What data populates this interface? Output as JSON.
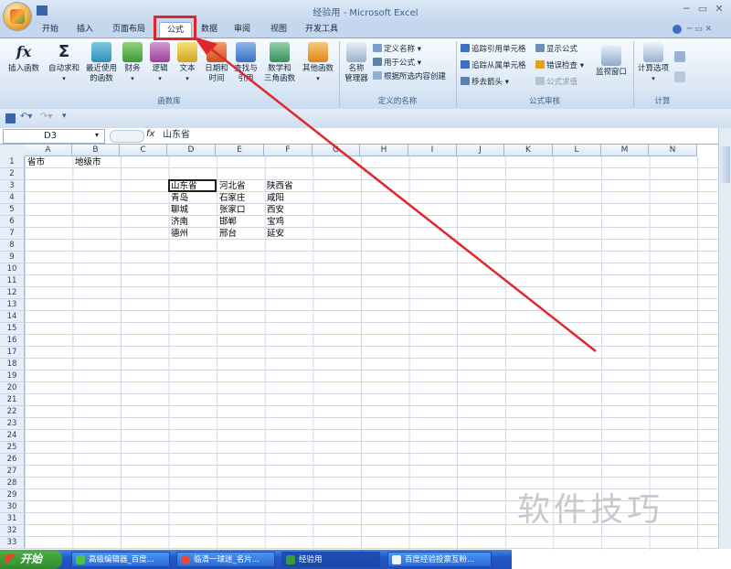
{
  "window": {
    "title": "经验用 - Microsoft Excel"
  },
  "tabs": [
    "开始",
    "插入",
    "页面布局",
    "公式",
    "数据",
    "审阅",
    "视图",
    "开发工具"
  ],
  "ribbon": {
    "function_library": {
      "label": "函数库",
      "buttons": [
        {
          "line1": "插入函数",
          "line2": "",
          "icon": "fx-icon"
        },
        {
          "line1": "自动求和",
          "line2": "",
          "icon": "sigma-icon"
        },
        {
          "line1": "最近使用",
          "line2": "的函数",
          "icon": "recent-book-icon"
        },
        {
          "line1": "财务",
          "line2": "",
          "icon": "finance-book-icon"
        },
        {
          "line1": "逻辑",
          "line2": "",
          "icon": "logic-book-icon"
        },
        {
          "line1": "文本",
          "line2": "",
          "icon": "text-book-icon"
        },
        {
          "line1": "日期和",
          "line2": "时间",
          "icon": "datetime-book-icon"
        },
        {
          "line1": "查找与",
          "line2": "引用",
          "icon": "lookup-book-icon"
        },
        {
          "line1": "数学和",
          "line2": "三角函数",
          "icon": "math-book-icon"
        },
        {
          "line1": "其他函数",
          "line2": "",
          "icon": "more-book-icon"
        }
      ]
    },
    "defined_names": {
      "label": "定义的名称",
      "name_manager_line1": "名称",
      "name_manager_line2": "管理器",
      "items": [
        "定义名称",
        "用于公式",
        "根据所选内容创建"
      ]
    },
    "formula_auditing": {
      "label": "公式审核",
      "left_items": [
        "追踪引用单元格",
        "追踪从属单元格",
        "移去箭头"
      ],
      "right_items": [
        "显示公式",
        "错误检查",
        "公式求值"
      ],
      "watch_window": "监视窗口"
    },
    "calculation": {
      "label": "计算",
      "options": "计算选项"
    }
  },
  "formula_bar": {
    "name_box": "D3",
    "fx": "fx",
    "value": "山东省"
  },
  "columns": [
    "A",
    "B",
    "C",
    "D",
    "E",
    "F",
    "G",
    "H",
    "I",
    "J",
    "K",
    "L",
    "M",
    "N"
  ],
  "rows": [
    "1",
    "2",
    "3",
    "4",
    "5",
    "6",
    "7",
    "8",
    "9",
    "10",
    "11",
    "12",
    "13",
    "14",
    "15",
    "16",
    "17",
    "18",
    "19",
    "20",
    "21",
    "22",
    "23",
    "24",
    "25",
    "26",
    "27",
    "28",
    "29",
    "30",
    "31",
    "32",
    "33"
  ],
  "cells": {
    "A1": "省市",
    "B1": "地级市",
    "D": [
      "山东省",
      "青岛",
      "聊城",
      "济南",
      "德州"
    ],
    "E": [
      "河北省",
      "石家庄",
      "张家口",
      "邯郸",
      "邢台"
    ],
    "F": [
      "陕西省",
      "咸阳",
      "西安",
      "宝鸡",
      "延安"
    ]
  },
  "taskbar": {
    "start": "开始",
    "tasks": [
      "高级编辑器_百度...",
      "临清一球迷_名片...",
      "经验用",
      "百度经验投票互粉..."
    ]
  },
  "watermark": "软件技巧",
  "colors": {
    "highlight": "#e0262a",
    "ribbon_bg": "#dbe7f5",
    "taskbar": "#2458c8"
  }
}
